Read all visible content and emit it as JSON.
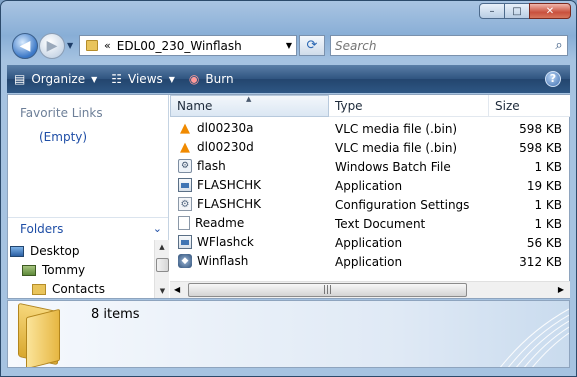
{
  "window": {
    "caption": {
      "minimize": "–",
      "maximize": "□",
      "close": "✕"
    }
  },
  "addressbar": {
    "chevron": "«",
    "path": "EDL00_230_Winflash"
  },
  "search": {
    "placeholder": "Search"
  },
  "toolbar": {
    "organize": "Organize",
    "views": "Views",
    "burn": "Burn",
    "help": "?"
  },
  "navpane": {
    "favorite_links": "Favorite Links",
    "empty": "(Empty)",
    "folders": "Folders",
    "tree": [
      {
        "label": "Desktop",
        "icon": "desktop-icon"
      },
      {
        "label": "Tommy",
        "icon": "user-folder-icon"
      },
      {
        "label": "Contacts",
        "icon": "folder-icon"
      }
    ]
  },
  "columns": {
    "name": "Name",
    "type": "Type",
    "size": "Size"
  },
  "files": [
    {
      "name": "dl00230a",
      "type": "VLC media file (.bin)",
      "size": "598 KB",
      "icon": "vlc-icon"
    },
    {
      "name": "dl00230d",
      "type": "VLC media file (.bin)",
      "size": "598 KB",
      "icon": "vlc-icon"
    },
    {
      "name": "flash",
      "type": "Windows Batch File",
      "size": "1 KB",
      "icon": "batch-file-icon"
    },
    {
      "name": "FLASHCHK",
      "type": "Application",
      "size": "19 KB",
      "icon": "application-icon"
    },
    {
      "name": "FLASHCHK",
      "type": "Configuration Settings",
      "size": "1 KB",
      "icon": "config-file-icon"
    },
    {
      "name": "Readme",
      "type": "Text Document",
      "size": "1 KB",
      "icon": "text-file-icon"
    },
    {
      "name": "WFlashck",
      "type": "Application",
      "size": "56 KB",
      "icon": "application-icon"
    },
    {
      "name": "Winflash",
      "type": "Application",
      "size": "312 KB",
      "icon": "setup-app-icon"
    }
  ],
  "details": {
    "item_count": "8 items"
  },
  "colors": {
    "toolbar": "#2f5480",
    "link": "#1f4ea6",
    "vlc": "#f08a00"
  }
}
